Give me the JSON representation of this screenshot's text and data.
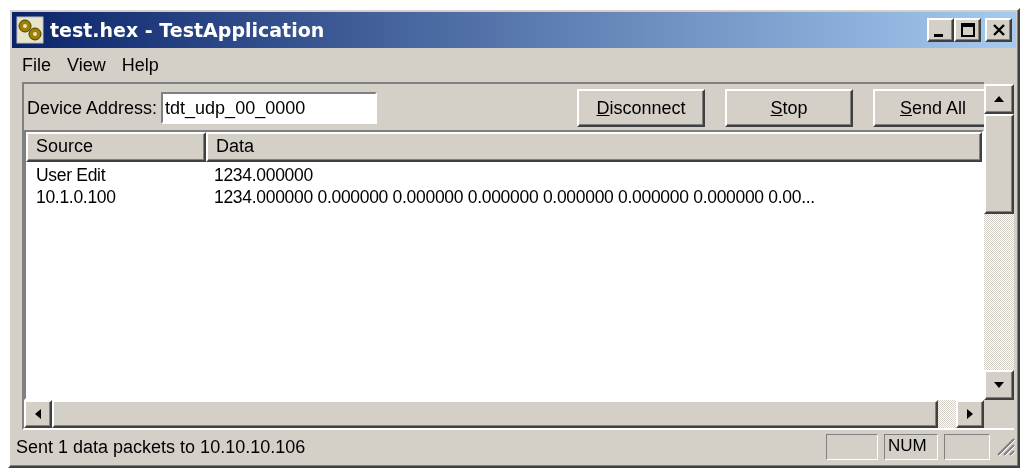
{
  "window": {
    "title": "test.hex - TestApplication"
  },
  "menu": [
    "File",
    "View",
    "Help"
  ],
  "toolbar": {
    "address_label": "Device Address:",
    "address_value": "tdt_udp_00_0000",
    "buttons": [
      {
        "label": "Disconnect"
      },
      {
        "label": "Stop"
      },
      {
        "label": "Send All"
      }
    ]
  },
  "table": {
    "columns": [
      "Source",
      "Data"
    ],
    "rows": [
      [
        "User Edit",
        "1234.000000"
      ],
      [
        "10.1.0.100",
        "1234.000000 0.000000 0.000000 0.000000 0.000000 0.000000 0.000000 0.00..."
      ]
    ]
  },
  "status_bar": {
    "message": "Sent 1 data packets to 10.10.10.106",
    "panes": [
      {
        "kind": "empty"
      },
      {
        "kind": "indicator",
        "text": "NUM"
      },
      {
        "kind": "empty"
      }
    ]
  }
}
